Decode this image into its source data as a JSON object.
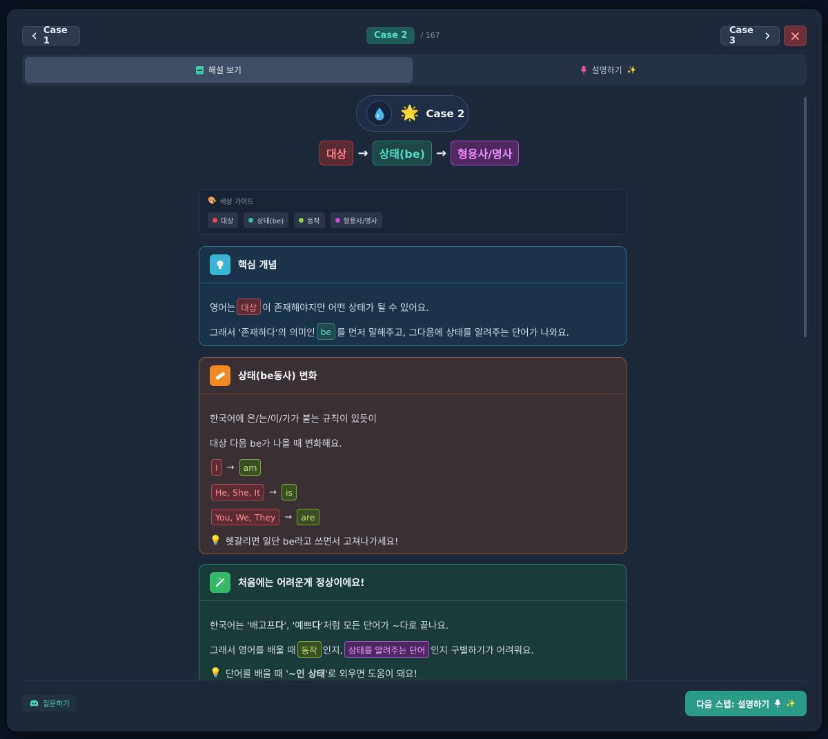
{
  "nav": {
    "prev_label": "Case 1",
    "next_label": "Case 3",
    "current_case": "Case 2",
    "total": "/ 167"
  },
  "tabs": [
    {
      "label": "해설 보기"
    },
    {
      "label": "설명하기"
    }
  ],
  "header": {
    "case_title": "Case 2",
    "formula": [
      "대상",
      "상태(be)",
      "형용사/명사"
    ]
  },
  "color_guide": {
    "title": "색상 가이드",
    "items": [
      {
        "label": "대상",
        "color": "#e5484d"
      },
      {
        "label": "상태(be)",
        "color": "#2cc4a8"
      },
      {
        "label": "동작",
        "color": "#8fd13a"
      },
      {
        "label": "형용사/명사",
        "color": "#d449e8"
      }
    ]
  },
  "card_core": {
    "title": "핵심 개념",
    "line1": {
      "a": "영어는 ",
      "tag": "대상",
      "b": "이 존재해야지만 어떤 상태가 될 수 있어요."
    },
    "line2": {
      "a": "그래서 '존재하다'의 의미인 ",
      "tag": "be",
      "b": "를 먼저 말해주고, 그다음에 상태를 알려주는 단어가 나와요."
    }
  },
  "card_be": {
    "title": "상태(be동사) 변화",
    "line1": "한국어에 은/는/이/가가 붙는 규칙이 있듯이",
    "line2": "대상 다음 be가 나올 때 변화해요.",
    "pairs": [
      {
        "subject": "I",
        "verb": "am"
      },
      {
        "subject": "He, She, It",
        "verb": "is"
      },
      {
        "subject": "You, We, They",
        "verb": "are"
      }
    ],
    "tip": "헷갈리면 일단 be라고 쓰면서 고쳐나가세요!"
  },
  "card_hard": {
    "title": "처음에는 어려운게 정상이에요!",
    "line1": {
      "a": "한국어는 '배고프",
      "b1": "다",
      "c": "', '예쁘",
      "b2": "다",
      "d": "'처럼 모든 단어가 ~다로 끝나요."
    },
    "line2": {
      "a": "그래서 영어를 배울 때 ",
      "tag1": "동작",
      "b": "인지, ",
      "tag2": "상태를 알려주는 단어",
      "c": "인지 구별하기가 어려워요."
    },
    "line3": {
      "a": "단어를 배울 때 '",
      "bold": "~인 상태",
      "b": "'로 외우면 도움이 돼요!"
    }
  },
  "footer": {
    "ask_label": "질문하기",
    "next_step_label": "다음 스텝: 설명하기"
  }
}
